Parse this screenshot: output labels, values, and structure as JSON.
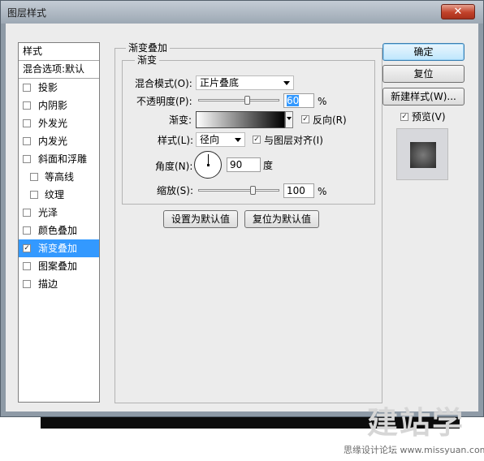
{
  "window": {
    "title": "图层样式",
    "close_glyph": "✕"
  },
  "sidebar": {
    "header": "样式",
    "blend_options": "混合选项:默认",
    "items": [
      {
        "label": "投影",
        "checked": false,
        "sub": false
      },
      {
        "label": "内阴影",
        "checked": false,
        "sub": false
      },
      {
        "label": "外发光",
        "checked": false,
        "sub": false
      },
      {
        "label": "内发光",
        "checked": false,
        "sub": false
      },
      {
        "label": "斜面和浮雕",
        "checked": false,
        "sub": false
      },
      {
        "label": "等高线",
        "checked": false,
        "sub": true
      },
      {
        "label": "纹理",
        "checked": false,
        "sub": true
      },
      {
        "label": "光泽",
        "checked": false,
        "sub": false
      },
      {
        "label": "颜色叠加",
        "checked": false,
        "sub": false
      },
      {
        "label": "渐变叠加",
        "checked": true,
        "sub": false,
        "selected": true
      },
      {
        "label": "图案叠加",
        "checked": false,
        "sub": false
      },
      {
        "label": "描边",
        "checked": false,
        "sub": false
      }
    ]
  },
  "panel": {
    "outer_title": "渐变叠加",
    "inner_title": "渐变",
    "blend_mode_label": "混合模式(O):",
    "blend_mode_value": "正片叠底",
    "opacity_label": "不透明度(P):",
    "opacity_value": "60",
    "opacity_level": 0.6,
    "percent": "%",
    "gradient_label": "渐变:",
    "gradient_colors": [
      "#ffffff",
      "#000000"
    ],
    "reverse_label": "反向(R)",
    "reverse_checked": true,
    "style_label": "样式(L):",
    "style_value": "径向",
    "align_label": "与图层对齐(I)",
    "align_checked": true,
    "angle_label": "角度(N):",
    "angle_value": "90",
    "angle_unit": "度",
    "scale_label": "缩放(S):",
    "scale_value": "100",
    "scale_level": 0.67,
    "make_default": "设置为默认值",
    "reset_default": "复位为默认值"
  },
  "actions": {
    "ok": "确定",
    "reset": "复位",
    "new_style": "新建样式(W)...",
    "preview_label": "预览(V)",
    "preview_checked": true
  },
  "watermark": {
    "big": "建站学",
    "small": "思缘设计论坛 www.missyuan.com"
  },
  "colors": {
    "selection": "#3399ff",
    "dialog_frame": "#8e9aa6",
    "close": "#c2422a"
  }
}
